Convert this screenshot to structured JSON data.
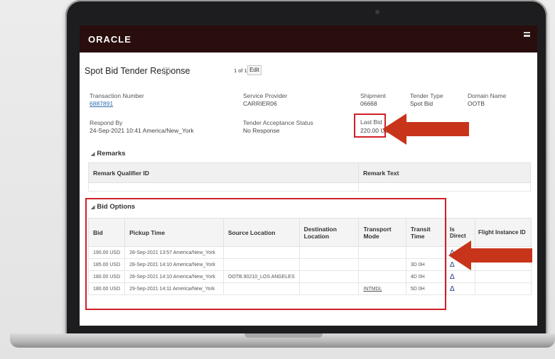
{
  "app": {
    "logo": "ORACLE"
  },
  "page": {
    "title": "Spot Bid Tender Response",
    "pagination": "1 of 1",
    "edit_label": "Edit"
  },
  "fields": {
    "transaction_number": {
      "label": "Transaction Number",
      "value": "6887891"
    },
    "service_provider": {
      "label": "Service Provider",
      "value": "CARRIER06"
    },
    "shipment": {
      "label": "Shipment",
      "value": "06668"
    },
    "tender_type": {
      "label": "Tender Type",
      "value": "Spot Bid"
    },
    "domain_name": {
      "label": "Domain Name",
      "value": "OOTB"
    },
    "respond_by": {
      "label": "Respond By",
      "value": "24-Sep-2021 10:41 America/New_York"
    },
    "tender_acceptance_status": {
      "label": "Tender Acceptance Status",
      "value": "No Response"
    },
    "last_bid": {
      "label": "Last Bid",
      "value": "220.00 USD"
    }
  },
  "remarks": {
    "section_title": "Remarks",
    "columns": [
      "Remark Qualifier ID",
      "Remark Text"
    ]
  },
  "bid_options": {
    "section_title": "Bid Options",
    "columns": [
      "Bid",
      "Pickup Time",
      "Source Location",
      "Destination Location",
      "Transport Mode",
      "Transit Time"
    ],
    "extra_columns": [
      "Is Direct",
      "Flight Instance ID"
    ],
    "rows": [
      [
        "190.00 USD",
        "28-Sep-2021 13:57 America/New_York",
        "",
        "",
        "",
        ""
      ],
      [
        "185.00 USD",
        "28-Sep-2021 14:10 America/New_York",
        "",
        "",
        "",
        "3D 0H"
      ],
      [
        "180.00 USD",
        "28-Sep-2021 14:10 America/New_York",
        "OOTB.90210_LOS ANGELES",
        "",
        "",
        "4D 0H"
      ],
      [
        "180.00 USD",
        "29-Sep-2021 14:11 America/New_York",
        "",
        "",
        "INTMDL",
        "5D 0H"
      ]
    ],
    "is_direct_glyph": "Δ"
  },
  "annotation": {
    "highlight_color": "#d01f26",
    "arrow_color": "#c8341a"
  }
}
